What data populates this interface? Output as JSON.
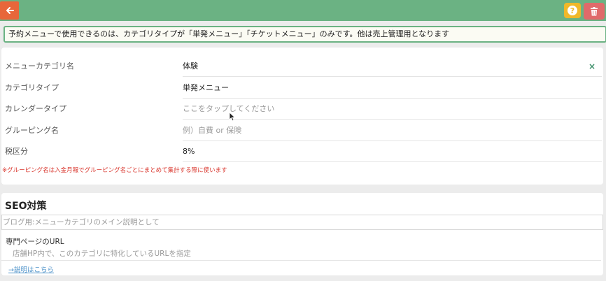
{
  "colors": {
    "header_bg": "#6bb283",
    "back_button": "#e8663a",
    "help_button": "#f0b829",
    "delete_button": "#e06a6a",
    "note_text": "#d9342b",
    "link": "#4a90c8"
  },
  "header": {
    "back_icon": "arrow-left-icon",
    "help_icon_glyph": "?",
    "help_icon": "question-circle-icon",
    "delete_icon": "trash-icon"
  },
  "notice": {
    "text": "予約メニューで使用できるのは、カテゴリタイプが「単発メニュー」「チケットメニュー」のみです。他は売上管理用となります"
  },
  "form": {
    "rows": [
      {
        "label": "メニューカテゴリ名",
        "value": "体験",
        "placeholder": false
      },
      {
        "label": "カテゴリタイプ",
        "value": "単発メニュー",
        "placeholder": false
      },
      {
        "label": "カレンダータイプ",
        "value": "ここをタップしてください",
        "placeholder": true
      },
      {
        "label": "グルーピング名",
        "value": "例）自費 or 保険",
        "placeholder": true
      },
      {
        "label": "税区分",
        "value": "8%",
        "placeholder": false
      }
    ],
    "clear_glyph": "×",
    "note": "※グルーピング名は入金月報でグルーピング名ごとにまとめて集計する際に使います"
  },
  "seo": {
    "title": "SEO対策",
    "description_placeholder": "ブログ用:メニューカテゴリのメイン説明として",
    "url_label": "専門ページのURL",
    "url_placeholder": "店舗HP内で、このカテゴリに特化しているURLを指定",
    "help_link": "→説明はこちら"
  }
}
